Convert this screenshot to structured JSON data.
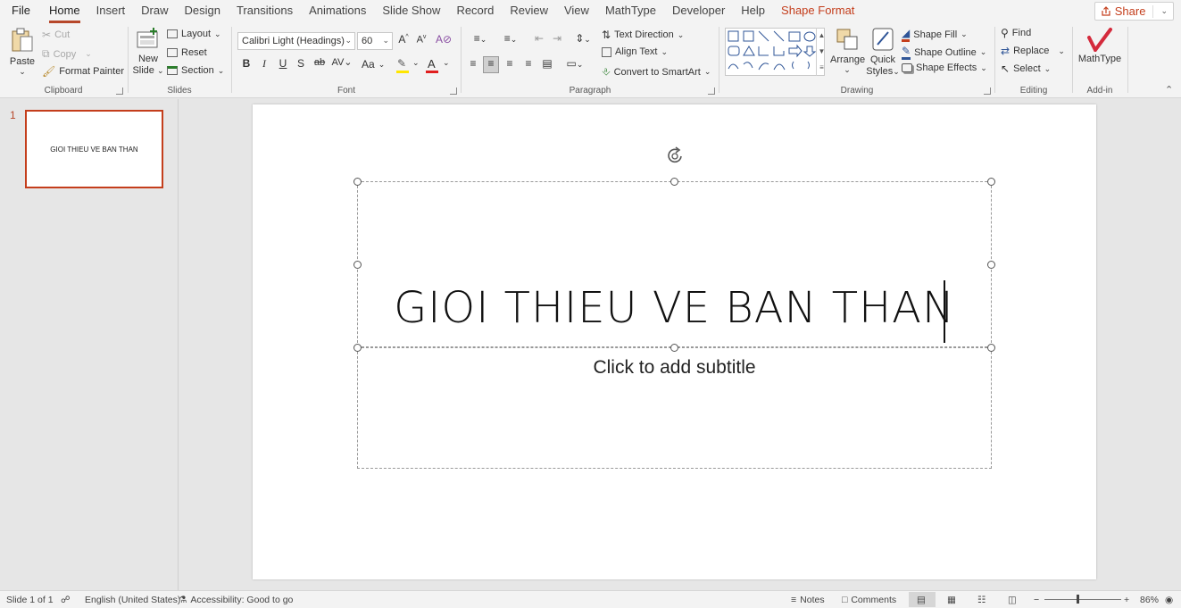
{
  "tabs": [
    "File",
    "Home",
    "Insert",
    "Draw",
    "Design",
    "Transitions",
    "Animations",
    "Slide Show",
    "Record",
    "Review",
    "View",
    "MathType",
    "Developer",
    "Help",
    "Shape Format"
  ],
  "active_tab": "Home",
  "share_label": "Share",
  "clipboard": {
    "paste": "Paste",
    "cut": "Cut",
    "copy": "Copy",
    "format_painter": "Format Painter",
    "label": "Clipboard"
  },
  "slides_group": {
    "new_slide_1": "New",
    "new_slide_2": "Slide",
    "layout": "Layout",
    "reset": "Reset",
    "section": "Section",
    "label": "Slides"
  },
  "font": {
    "name": "Calibri Light (Headings)",
    "size": "60",
    "label": "Font",
    "case": "Aa"
  },
  "paragraph": {
    "text_direction": "Text Direction",
    "align_text": "Align Text",
    "convert_smartart": "Convert to SmartArt",
    "label": "Paragraph"
  },
  "drawing": {
    "arrange": "Arrange",
    "quick_styles_1": "Quick",
    "quick_styles_2": "Styles",
    "shape_fill": "Shape Fill",
    "shape_outline": "Shape Outline",
    "shape_effects": "Shape Effects",
    "label": "Drawing"
  },
  "editing": {
    "find": "Find",
    "replace": "Replace",
    "select": "Select",
    "label": "Editing"
  },
  "addin": {
    "mathtype": "MathType",
    "label": "Add-in"
  },
  "thumbnail": {
    "number": "1",
    "text": "GIOI THIEU VE BAN THAN"
  },
  "slide": {
    "title": "GIOI THIEU VE BAN THAN",
    "subtitle_placeholder": "Click to add subtitle"
  },
  "status": {
    "slide_info": "Slide 1 of 1",
    "language": "English (United States)",
    "accessibility": "Accessibility: Good to go",
    "notes": "Notes",
    "comments": "Comments",
    "zoom": "86%"
  },
  "colors": {
    "accent": "#b7472a",
    "context_tab": "#c43e1c"
  }
}
